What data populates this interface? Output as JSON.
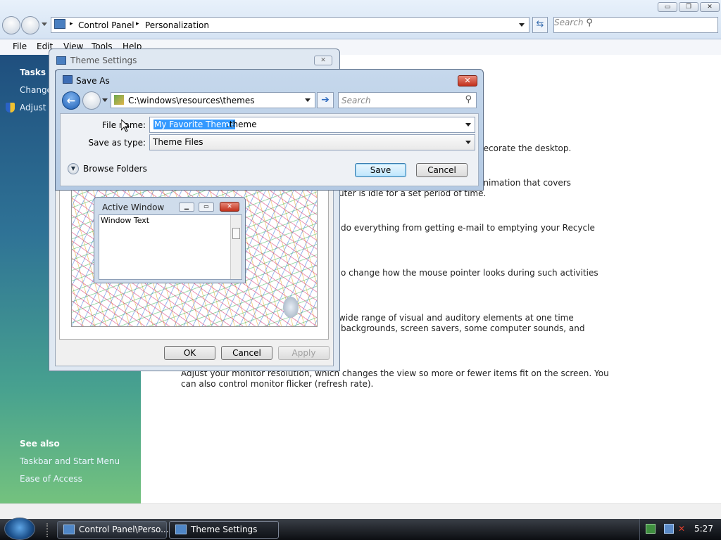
{
  "window": {
    "minimize_symbol": "▭",
    "maximize_symbol": "❐",
    "close_symbol": "✕"
  },
  "address": {
    "segments": [
      "Control Panel",
      "Personalization"
    ],
    "separator": "▸"
  },
  "search": {
    "placeholder": "Search"
  },
  "menu": [
    "File",
    "Edit",
    "View",
    "Tools",
    "Help"
  ],
  "sidebar": {
    "tasks_heading": "Tasks",
    "tasks": [
      "Change",
      "Adjust f"
    ],
    "see_also_heading": "See also",
    "see_also": [
      "Taskbar and Start Menu",
      "Ease of Access"
    ]
  },
  "content_lines": [
    "decorate the desktop.",
    "animation that covers",
    "uter is idle for a set period of time.",
    "do everything from getting e-mail to emptying your Recycle",
    "o change how the mouse pointer looks during such activities",
    "wide range of visual and auditory elements at one time",
    "backgrounds, screen savers, some computer sounds, and",
    "Adjust your monitor resolution, which changes the view so more or fewer items fit on the screen. You",
    "can also control monitor flicker (refresh rate)."
  ],
  "theme_settings": {
    "title": "Theme Settings",
    "preview": {
      "active_window_title": "Active Window",
      "window_text": "Window Text"
    },
    "ok": "OK",
    "cancel": "Cancel",
    "apply": "Apply"
  },
  "save_as": {
    "title": "Save As",
    "path": "C:\\windows\\resources\\themes",
    "search_placeholder": "Search",
    "file_name_label": "File name:",
    "file_name_selected": "My Favorite Theme",
    "file_name_ext": ".theme",
    "save_type_label": "Save as type:",
    "save_type_value": "Theme Files",
    "browse_folders": "Browse Folders",
    "save": "Save",
    "cancel": "Cancel"
  },
  "taskbar": {
    "items": [
      "Control Panel\\Perso...",
      "Theme Settings"
    ],
    "clock": "5:27"
  },
  "colors": {
    "accent": "#3a78d4",
    "selection": "#3399ff",
    "close_red": "#c2311c"
  }
}
